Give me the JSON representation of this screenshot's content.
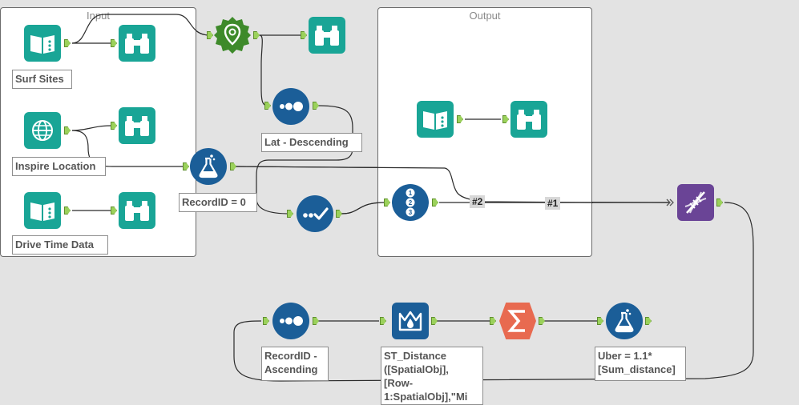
{
  "containers": {
    "input": {
      "title": "Input"
    },
    "output": {
      "title": "Output"
    }
  },
  "labels": {
    "surf_sites": "Surf Sites",
    "inspire_location": "Inspire Location",
    "drive_time_data": "Drive Time Data",
    "lat_descending": "Lat - Descending",
    "recordid_zero": "RecordID = 0",
    "recordid_ascending": "RecordID -\nAscending",
    "st_distance": "ST_Distance\n([SpatialObj],\n[Row-\n1:SpatialObj],\"Mi",
    "uber": "Uber = 1.1*\n[Sum_distance]"
  },
  "connection_labels": {
    "hash2": "#2",
    "hash1": "#1"
  },
  "colors": {
    "canvas": "#e3e3e3",
    "teal_tool": "#19a596",
    "blue_tool": "#1b5e98",
    "green_tool": "#3e8a2a",
    "orange_tool": "#e86a50",
    "purple_tool": "#6a4496",
    "anchor": "#9bd15b"
  },
  "icons": {
    "input_data": "book-open-icon",
    "browse": "binoculars-icon",
    "text_input": "globe-icon",
    "spatial_info": "location-pin-icon",
    "sort": "dots-icon",
    "formula": "flask-icon",
    "filter": "check-icon",
    "record_id": "numbered-list-icon",
    "multi_row_formula": "crown-icon",
    "summarize": "sigma-icon",
    "join_multiple": "dna-icon"
  }
}
